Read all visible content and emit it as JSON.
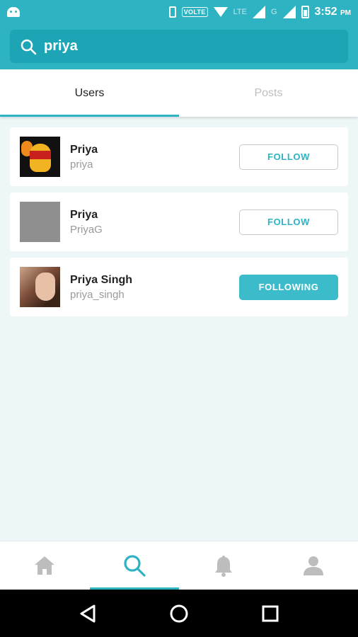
{
  "status_bar": {
    "volte": "VOLTE",
    "network_lte": "LTE",
    "network_g": "G",
    "time": "3:52",
    "ampm": "PM"
  },
  "search": {
    "value": "priya",
    "placeholder": "Search"
  },
  "tabs": [
    {
      "label": "Users",
      "active": true
    },
    {
      "label": "Posts",
      "active": false
    }
  ],
  "users": [
    {
      "name": "Priya",
      "username": "priya",
      "button": "FOLLOW"
    },
    {
      "name": "Priya",
      "username": "PriyaG",
      "button": "FOLLOW"
    },
    {
      "name": "Priya Singh",
      "username": "priya_singh",
      "button": "FOLLOWING"
    }
  ],
  "bottom_nav": [
    {
      "icon": "home-icon"
    },
    {
      "icon": "search-icon",
      "active": true
    },
    {
      "icon": "bell-icon"
    },
    {
      "icon": "profile-icon"
    }
  ],
  "colors": {
    "accent": "#2eb3c2",
    "search_bg": "#1ea5b5",
    "following_bg": "#3cbccb"
  }
}
